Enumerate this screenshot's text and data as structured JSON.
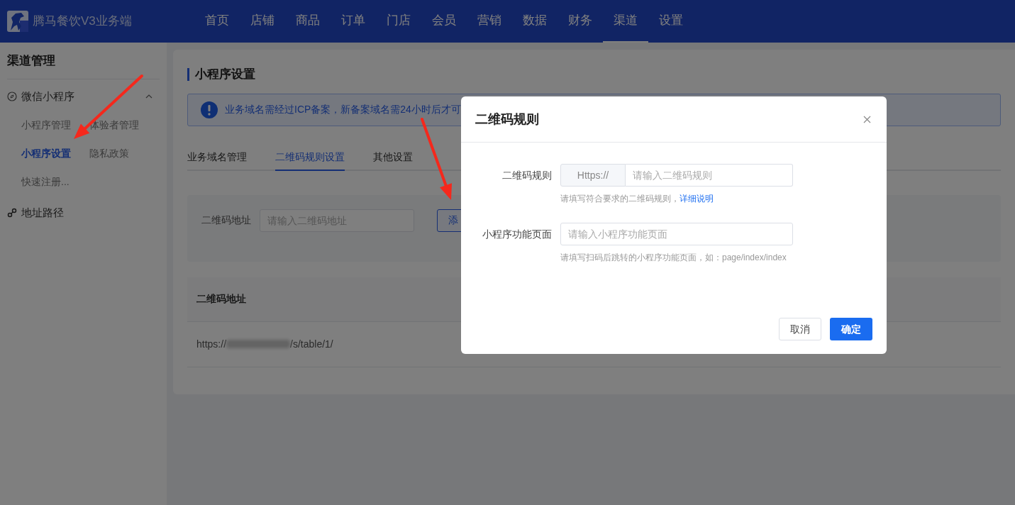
{
  "header": {
    "brand": "腾马餐饮V3业务端",
    "nav": [
      {
        "label": "首页",
        "selected": false
      },
      {
        "label": "店铺",
        "selected": false
      },
      {
        "label": "商品",
        "selected": false
      },
      {
        "label": "订单",
        "selected": false
      },
      {
        "label": "门店",
        "selected": false
      },
      {
        "label": "会员",
        "selected": false
      },
      {
        "label": "营销",
        "selected": false
      },
      {
        "label": "数据",
        "selected": false
      },
      {
        "label": "财务",
        "selected": false
      },
      {
        "label": "渠道",
        "selected": true
      },
      {
        "label": "设置",
        "selected": false
      }
    ]
  },
  "sidebar": {
    "title": "渠道管理",
    "groups": [
      {
        "label": "微信小程序",
        "kind": "mini",
        "expanded": true,
        "children": [
          {
            "label": "小程序管理",
            "selected": false
          },
          {
            "label": "体验者管理",
            "selected": false
          },
          {
            "label": "小程序设置",
            "selected": true
          },
          {
            "label": "隐私政策",
            "selected": false
          },
          {
            "label": "快速注册...",
            "selected": false
          }
        ]
      },
      {
        "label": "地址路径",
        "kind": "link"
      }
    ]
  },
  "page": {
    "title": "小程序设置",
    "alert": "业务域名需经过ICP备案，新备案域名需24小时后才可",
    "tabs": [
      {
        "label": "业务域名管理",
        "selected": false
      },
      {
        "label": "二维码规则设置",
        "selected": true
      },
      {
        "label": "其他设置",
        "selected": false
      }
    ],
    "filter": {
      "label": "二维码地址",
      "placeholder": "请输入二维码地址",
      "button": "添"
    },
    "table": {
      "columns": [
        "二维码地址"
      ],
      "rows": [
        {
          "prefix": "https://",
          "suffix": "/s/table/1/"
        }
      ]
    }
  },
  "modal": {
    "title": "二维码规则",
    "fields": [
      {
        "label": "二维码规则",
        "prefix": "Https://",
        "placeholder": "请输入二维码规则",
        "hint": "请填写符合要求的二维码规则，",
        "hint_link": "详细说明"
      },
      {
        "label": "小程序功能页面",
        "placeholder": "请输入小程序功能页面",
        "hint": "请填写扫码后跳转的小程序功能页面，如：page/index/index"
      }
    ],
    "buttons": [
      {
        "label": "取消",
        "kind": "default"
      },
      {
        "label": "确定",
        "kind": "primary"
      }
    ]
  }
}
